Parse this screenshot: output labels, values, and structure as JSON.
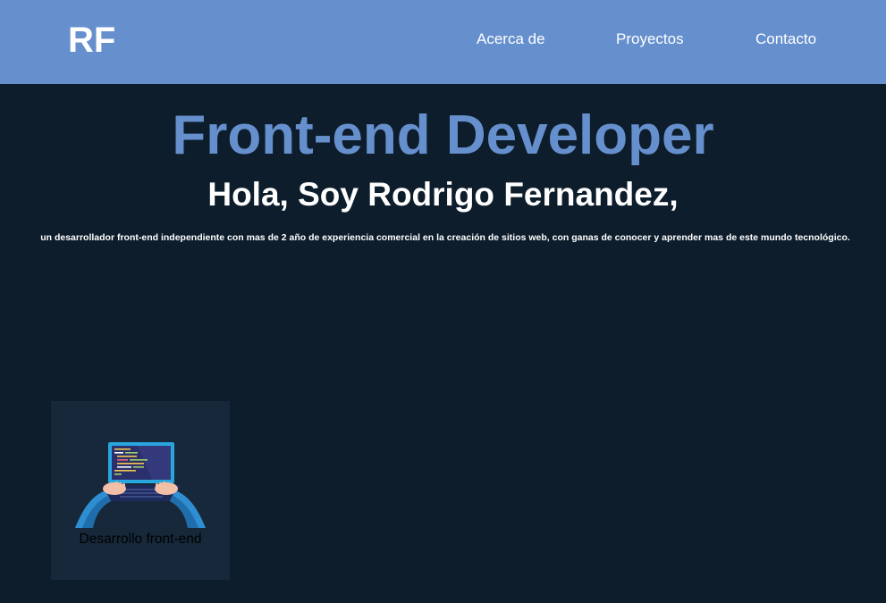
{
  "nav": {
    "logo": "RF",
    "links": [
      "Acerca de",
      "Proyectos",
      "Contacto"
    ]
  },
  "hero": {
    "title": "Front-end Developer",
    "subtitle": "Hola, Soy Rodrigo Fernandez,",
    "description": "un desarrollador front-end independiente con mas de 2 año de experiencia comercial en la creación de sitios web, con ganas de conocer y aprender mas de este mundo tecnológico."
  },
  "services": [
    {
      "label": "Desarrollo front-end",
      "icon": "laptop-coding-illustration"
    }
  ],
  "colors": {
    "nav_bg": "#6690cd",
    "page_bg": "#0d1d2b",
    "card_bg": "#16283a",
    "accent": "#6690cd"
  }
}
